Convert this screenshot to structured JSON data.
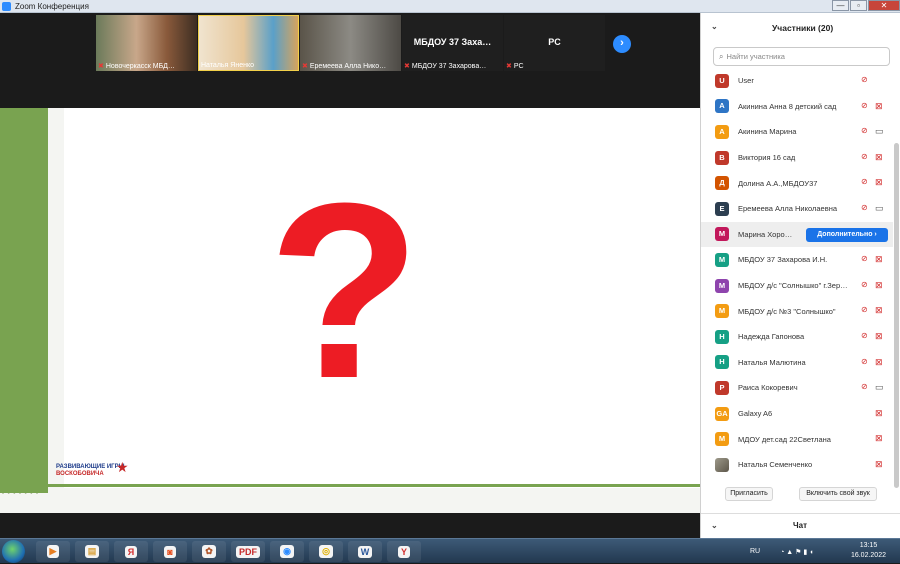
{
  "window": {
    "title": "Zoom Конференция",
    "minimize": "—",
    "maximize": "▫",
    "close": "✕"
  },
  "thumbnails": [
    {
      "name": "Новочеркасск МБД…",
      "video": true
    },
    {
      "name": "Наталья Яненко",
      "video": true
    },
    {
      "name": "Еремеева Алла Нико…",
      "video": true
    },
    {
      "name": "МБДОУ 37 Захарова…",
      "big": "МБДОУ 37 Заха…",
      "video": false
    },
    {
      "name": "PC",
      "big": "PC",
      "video": false
    }
  ],
  "slide": {
    "symbol": "?",
    "logo_line1": "РАЗВИВАЮЩИЕ ИГРЫ",
    "logo_line2": "ВОСКОБОВИЧА",
    "footer_marks": "- - - - - - -"
  },
  "participants_panel": {
    "title": "Участники (20)",
    "search_placeholder": "Найти участника",
    "participants": [
      {
        "initial": "U",
        "name": "User",
        "color": "#c0392b",
        "mic": "muted",
        "cam": "none"
      },
      {
        "initial": "A",
        "name": "Акинина Анна 8 детский сад",
        "color": "#2e75c5",
        "mic": "muted",
        "cam": "off"
      },
      {
        "initial": "A",
        "name": "Акинина Марина",
        "color": "#f39c12",
        "mic": "muted",
        "cam": "on"
      },
      {
        "initial": "B",
        "name": "Виктория 16 сад",
        "color": "#c0392b",
        "mic": "muted",
        "cam": "off"
      },
      {
        "initial": "Д",
        "name": "Долина А.А.,МБДОУ37",
        "color": "#d35400",
        "mic": "muted",
        "cam": "off"
      },
      {
        "initial": "E",
        "name": "Еремеева Алла Николаевна",
        "color": "#2c3e50",
        "mic": "muted",
        "cam": "on"
      },
      {
        "initial": "M",
        "name": "Марина Хоро…",
        "color": "#c2185b",
        "mic": "none",
        "cam": "none",
        "more": "Дополнительно ›"
      },
      {
        "initial": "M",
        "name": "МБДОУ 37 Захарова И.Н.",
        "color": "#16a085",
        "mic": "muted",
        "cam": "off"
      },
      {
        "initial": "M",
        "name": "МБДОУ д/с \"Солнышко\" г.Зер…",
        "color": "#8e44ad",
        "mic": "muted",
        "cam": "off"
      },
      {
        "initial": "M",
        "name": "МБДОУ д/с №3 \"Солнышко\"",
        "color": "#f39c12",
        "mic": "muted",
        "cam": "off"
      },
      {
        "initial": "H",
        "name": "Надежда Гапонова",
        "color": "#16a085",
        "mic": "muted",
        "cam": "off"
      },
      {
        "initial": "H",
        "name": "Наталья Малютина",
        "color": "#16a085",
        "mic": "muted",
        "cam": "off"
      },
      {
        "initial": "P",
        "name": "Раиса Кокоревич",
        "color": "#c0392b",
        "mic": "muted",
        "cam": "on"
      },
      {
        "initial": "GA",
        "name": "Galaxy A6",
        "color": "#f39c12",
        "mic": "none",
        "cam": "off"
      },
      {
        "initial": "M",
        "name": "МДОУ дет.сад 22Светлана",
        "color": "#f39c12",
        "mic": "none",
        "cam": "off"
      },
      {
        "initial": "",
        "name": "Наталья Семенченко",
        "color": "photo",
        "mic": "none",
        "cam": "off"
      }
    ],
    "invite_label": "Пригласить",
    "unmute_label": "Включить свой звук",
    "chat_label": "Чат"
  },
  "taskbar": {
    "apps": [
      {
        "label": "▶",
        "color": "#e67e22"
      },
      {
        "label": "▤",
        "color": "#d9a441"
      },
      {
        "label": "Я",
        "color": "#d32f2f"
      },
      {
        "label": "◙",
        "color": "#e64a19"
      },
      {
        "label": "✿",
        "color": "#b0552a"
      },
      {
        "label": "PDF",
        "color": "#c62828"
      },
      {
        "label": "◉",
        "color": "#2d8cff"
      },
      {
        "label": "◎",
        "color": "#e0b000"
      },
      {
        "label": "W",
        "color": "#2b579a"
      },
      {
        "label": "Y",
        "color": "#d32f2f"
      }
    ],
    "lang": "RU",
    "time": "13:15",
    "date": "16.02.2022"
  }
}
